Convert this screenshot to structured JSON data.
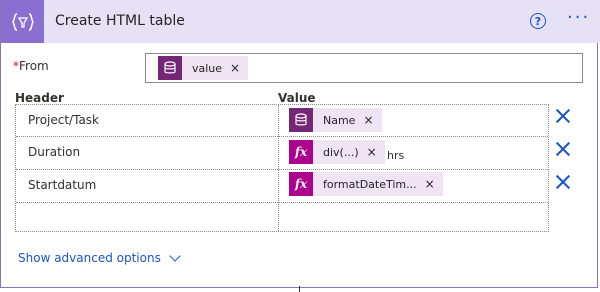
{
  "action": {
    "title": "Create HTML table"
  },
  "from": {
    "label": "From",
    "required_mark": "*",
    "token": {
      "label": "value",
      "remove": "×",
      "icon": "variable-icon"
    }
  },
  "columns": {
    "header_label": "Header",
    "value_label": "Value"
  },
  "rows": [
    {
      "header": "Project/Task",
      "token": {
        "type": "variable",
        "label": "Name",
        "remove": "×"
      },
      "trailing": ""
    },
    {
      "header": "Duration",
      "token": {
        "type": "expression",
        "label": "div(...)",
        "remove": "×"
      },
      "trailing": "hrs"
    },
    {
      "header": "Startdatum",
      "token": {
        "type": "expression",
        "label": "formatDateTim...",
        "remove": "×"
      },
      "trailing": ""
    }
  ],
  "fx_glyph": "fx",
  "header_icons": {
    "help": "?",
    "more": "···"
  },
  "advanced": {
    "label": "Show advanced options"
  },
  "colors": {
    "header_bg": "#e7e1f6",
    "action_icon_bg": "#8b6fd0",
    "variable_token": "#742774",
    "expression_token": "#ad008c",
    "link": "#1a55c7"
  }
}
